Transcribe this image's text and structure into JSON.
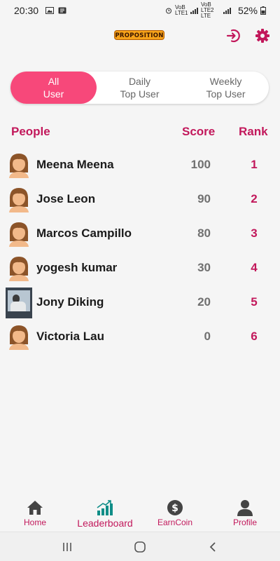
{
  "status": {
    "time": "20:30",
    "lte1": "VoB LTE1",
    "lte2": "VoB LTE2 LTE",
    "battery": "52%"
  },
  "header": {
    "logo_text": "PROPOSITION"
  },
  "tabs": [
    {
      "line1": "All",
      "line2": "User",
      "active": true
    },
    {
      "line1": "Daily",
      "line2": "Top User",
      "active": false
    },
    {
      "line1": "Weekly",
      "line2": "Top User",
      "active": false
    }
  ],
  "table": {
    "headers": {
      "people": "People",
      "score": "Score",
      "rank": "Rank"
    },
    "rows": [
      {
        "name": "Meena Meena",
        "score": "100",
        "rank": "1",
        "avatar": "default-avatar"
      },
      {
        "name": "Jose Leon",
        "score": "90",
        "rank": "2",
        "avatar": "default-avatar"
      },
      {
        "name": "Marcos Campillo",
        "score": "80",
        "rank": "3",
        "avatar": "default-avatar"
      },
      {
        "name": "yogesh kumar",
        "score": "30",
        "rank": "4",
        "avatar": "default-avatar"
      },
      {
        "name": "Jony Diking",
        "score": "20",
        "rank": "5",
        "avatar": "photo"
      },
      {
        "name": "Victoria Lau",
        "score": "0",
        "rank": "6",
        "avatar": "default-avatar"
      }
    ]
  },
  "nav": [
    {
      "label": "Home",
      "icon": "home-icon"
    },
    {
      "label": "Leaderboard",
      "icon": "leaderboard-icon"
    },
    {
      "label": "EarnCoin",
      "icon": "coin-icon"
    },
    {
      "label": "Profile",
      "icon": "profile-icon"
    }
  ],
  "colors": {
    "accent": "#c2185b",
    "active_tab": "#f7487a",
    "teal": "#0f8d87"
  }
}
